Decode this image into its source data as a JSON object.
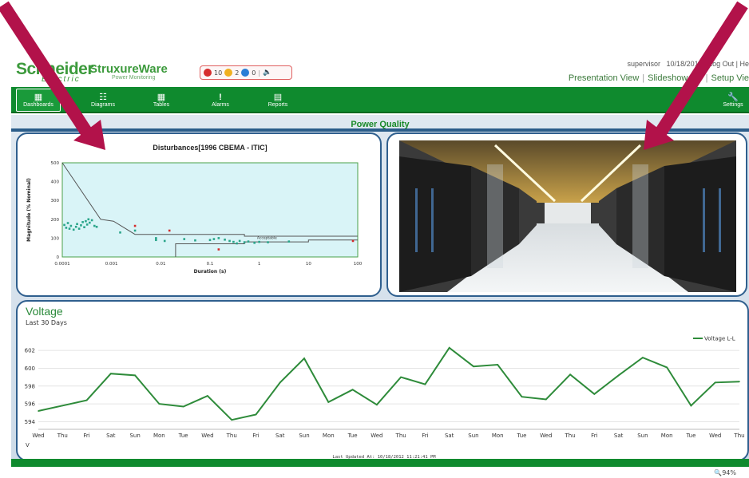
{
  "header": {
    "brand": "Schneider",
    "brand_sub": "Electric",
    "product": "StruxureWare",
    "product_sub": "Power Monitoring",
    "alarms": {
      "red_count": "10",
      "yellow_count": "2",
      "blue_count": "0"
    },
    "user": "supervisor",
    "date": "10/18/2012",
    "logout": "Log Out",
    "help": "He",
    "views": [
      "Presentation View",
      "Slideshow",
      "Setup Vie"
    ]
  },
  "nav": {
    "items": [
      {
        "label": "Dashboards",
        "icon": "dashboard-icon"
      },
      {
        "label": "Diagrams",
        "icon": "diagram-icon"
      },
      {
        "label": "Tables",
        "icon": "table-icon"
      },
      {
        "label": "Alarms",
        "icon": "exclamation-icon"
      },
      {
        "label": "Reports",
        "icon": "report-icon"
      },
      {
        "label": "Settings",
        "icon": "wrench-icon"
      }
    ]
  },
  "dashboard": {
    "title": "Power Quality",
    "voltage_title": "Voltage",
    "voltage_subtitle": "Last 30 Days",
    "last_updated": "Last Updated At: 10/18/2012 11:21:41 PM",
    "zoom": "94%"
  },
  "colors": {
    "brand_green": "#3c9a3c",
    "nav_green": "#0f8a2e",
    "panel_border": "#2f5f8e",
    "line_green": "#2e8b3a",
    "arrow": "#b2124a"
  },
  "chart_data": [
    {
      "type": "scatter",
      "title": "Disturbances[1996 CBEMA - ITIC]",
      "xlabel": "Duration (s)",
      "ylabel": "Magnitude (% Nominal)",
      "x_scale": "log",
      "xlim": [
        0.0001,
        100
      ],
      "ylim": [
        0,
        500
      ],
      "x_ticks": [
        "0.0001",
        "0.001",
        "0.01",
        "0.1",
        "1",
        "10",
        "100"
      ],
      "y_ticks": [
        "0",
        "100",
        "200",
        "300",
        "400",
        "500"
      ],
      "annotation": "Acceptable",
      "upper_curve": [
        [
          0.0001,
          500
        ],
        [
          0.0006,
          200
        ],
        [
          0.0011,
          190
        ],
        [
          0.003,
          120
        ],
        [
          0.02,
          120
        ],
        [
          0.5,
          120
        ],
        [
          0.5,
          110
        ],
        [
          100,
          110
        ]
      ],
      "lower_curve": [
        [
          0.02,
          0
        ],
        [
          0.02,
          70
        ],
        [
          0.5,
          70
        ],
        [
          0.5,
          80
        ],
        [
          10,
          80
        ],
        [
          10,
          90
        ],
        [
          100,
          90
        ]
      ],
      "series": [
        {
          "name": "",
          "color": "#2aa58a",
          "points": [
            [
              0.00011,
              170
            ],
            [
              0.00012,
              155
            ],
            [
              0.00013,
              180
            ],
            [
              0.00014,
              150
            ],
            [
              0.00015,
              165
            ],
            [
              0.00017,
              145
            ],
            [
              0.00019,
              160
            ],
            [
              0.0002,
              175
            ],
            [
              0.00022,
              150
            ],
            [
              0.00024,
              168
            ],
            [
              0.00026,
              185
            ],
            [
              0.00028,
              158
            ],
            [
              0.0003,
              190
            ],
            [
              0.00032,
              172
            ],
            [
              0.00034,
              200
            ],
            [
              0.00036,
              182
            ],
            [
              0.0004,
              195
            ],
            [
              0.00045,
              165
            ],
            [
              0.0005,
              160
            ],
            [
              0.0015,
              130
            ],
            [
              0.003,
              140
            ],
            [
              0.008,
              100
            ],
            [
              0.008,
              90
            ],
            [
              0.012,
              85
            ],
            [
              0.03,
              95
            ],
            [
              0.05,
              88
            ],
            [
              0.1,
              90
            ],
            [
              0.12,
              95
            ],
            [
              0.15,
              100
            ],
            [
              0.2,
              92
            ],
            [
              0.25,
              85
            ],
            [
              0.3,
              80
            ],
            [
              0.35,
              72
            ],
            [
              0.4,
              85
            ],
            [
              0.5,
              78
            ],
            [
              0.6,
              82
            ],
            [
              0.8,
              75
            ],
            [
              1,
              80
            ],
            [
              1.5,
              78
            ],
            [
              4,
              82
            ]
          ]
        },
        {
          "name": "",
          "color": "#d42a2a",
          "points": [
            [
              0.003,
              165
            ],
            [
              0.015,
              140
            ],
            [
              0.15,
              40
            ],
            [
              80,
              85
            ]
          ]
        }
      ]
    },
    {
      "type": "line",
      "title": "",
      "xlabel": "",
      "ylabel": "V",
      "legend": "top-right",
      "ylim": [
        593.5,
        603
      ],
      "y_ticks": [
        "594",
        "596",
        "598",
        "600",
        "602"
      ],
      "categories": [
        "Wed",
        "Thu",
        "Fri",
        "Sat",
        "Sun",
        "Mon",
        "Tue",
        "Wed",
        "Thu",
        "Fri",
        "Sat",
        "Sun",
        "Mon",
        "Tue",
        "Wed",
        "Thu",
        "Fri",
        "Sat",
        "Sun",
        "Mon",
        "Tue",
        "Wed",
        "Thu",
        "Fri",
        "Sat",
        "Sun",
        "Mon",
        "Tue",
        "Wed",
        "Thu"
      ],
      "series": [
        {
          "name": "Voltage L-L",
          "color": "#2e8b3a",
          "values": [
            595.2,
            595.8,
            596.4,
            599.4,
            599.2,
            596.0,
            595.7,
            596.9,
            594.2,
            594.8,
            598.4,
            601.1,
            596.2,
            597.6,
            595.9,
            599.0,
            598.2,
            602.3,
            600.2,
            600.4,
            596.8,
            596.5,
            599.3,
            597.1,
            599.2,
            601.2,
            600.1,
            595.8,
            598.4,
            598.5
          ]
        }
      ]
    }
  ]
}
